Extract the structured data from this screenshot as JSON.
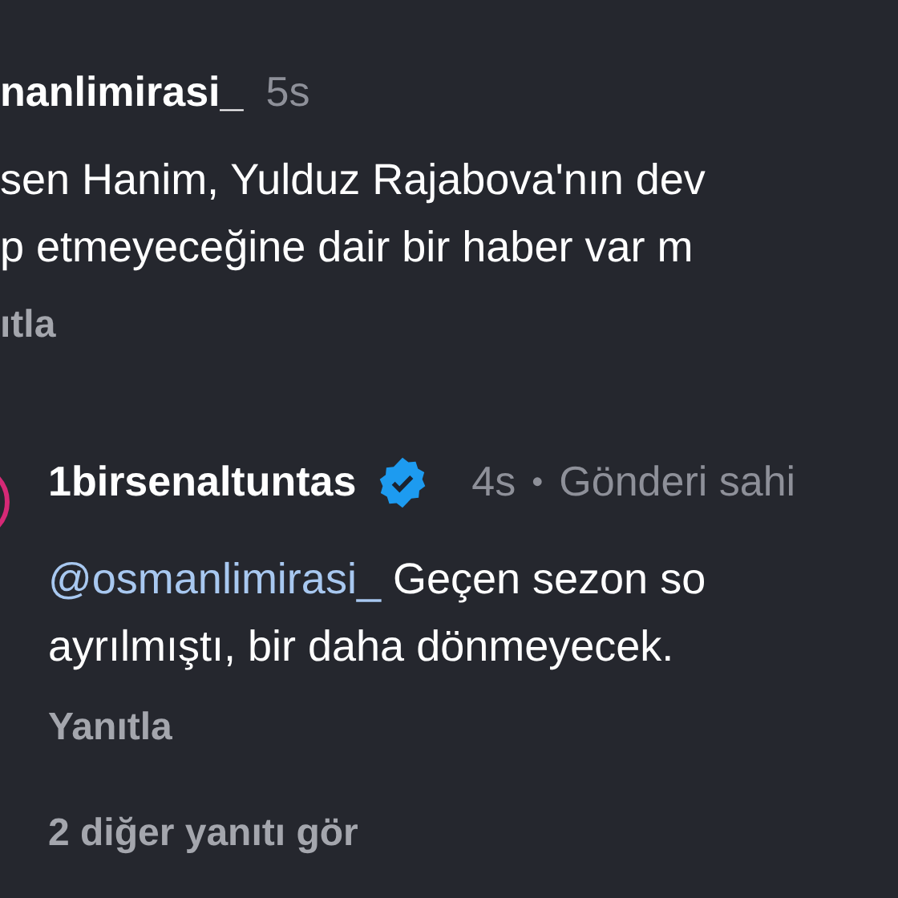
{
  "comment": {
    "username": "nanlimirasi_",
    "time": "5s",
    "lines": [
      "sen Hanim, Yulduz Rajabova'nın dev",
      "p etmeyeceğine dair bir haber var m"
    ],
    "reply_label": "ıtla"
  },
  "reply": {
    "username": "1birsenaltuntas",
    "verified": true,
    "time": "4s",
    "separator": "•",
    "owner_label": "Gönderi sahi",
    "mention": "@osmanlimirasi_",
    "lines": [
      "Geçen sezon so",
      "ayrılmıştı, bir daha dönmeyecek."
    ],
    "reply_label": "Yanıtla"
  },
  "more_replies": "2 diğer yanıtı gör"
}
